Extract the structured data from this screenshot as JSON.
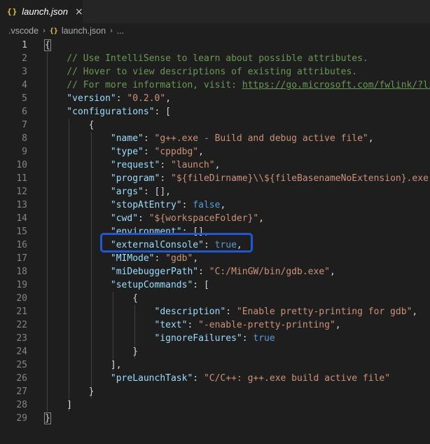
{
  "tab": {
    "icon": "{}",
    "title": "launch.json",
    "close_icon": "×"
  },
  "breadcrumb": {
    "items": [
      ".vscode",
      "launch.json",
      "..."
    ],
    "separator": "›",
    "file_icon": "{}"
  },
  "lines": [
    {
      "n": "1",
      "indent": 0,
      "tokens": [
        {
          "t": "{",
          "c": "p"
        }
      ]
    },
    {
      "n": "2",
      "indent": 1,
      "tokens": [
        {
          "t": "// Use IntelliSense to learn about possible attributes.",
          "c": "c"
        }
      ]
    },
    {
      "n": "3",
      "indent": 1,
      "tokens": [
        {
          "t": "// Hover to view descriptions of existing attributes.",
          "c": "c"
        }
      ]
    },
    {
      "n": "4",
      "indent": 1,
      "tokens": [
        {
          "t": "// For more information, visit: ",
          "c": "c"
        },
        {
          "t": "https://go.microsoft.com/fwlink/?lin",
          "c": "c u"
        }
      ]
    },
    {
      "n": "5",
      "indent": 1,
      "tokens": [
        {
          "t": "\"version\"",
          "c": "k"
        },
        {
          "t": ": ",
          "c": "p"
        },
        {
          "t": "\"0.2.0\"",
          "c": "s"
        },
        {
          "t": ",",
          "c": "p"
        }
      ]
    },
    {
      "n": "6",
      "indent": 1,
      "tokens": [
        {
          "t": "\"configurations\"",
          "c": "k"
        },
        {
          "t": ": [",
          "c": "p"
        }
      ]
    },
    {
      "n": "7",
      "indent": 2,
      "tokens": [
        {
          "t": "{",
          "c": "p"
        }
      ]
    },
    {
      "n": "8",
      "indent": 3,
      "tokens": [
        {
          "t": "\"name\"",
          "c": "k"
        },
        {
          "t": ": ",
          "c": "p"
        },
        {
          "t": "\"g++.exe - Build and debug active file\"",
          "c": "s"
        },
        {
          "t": ",",
          "c": "p"
        }
      ]
    },
    {
      "n": "9",
      "indent": 3,
      "tokens": [
        {
          "t": "\"type\"",
          "c": "k"
        },
        {
          "t": ": ",
          "c": "p"
        },
        {
          "t": "\"cppdbg\"",
          "c": "s"
        },
        {
          "t": ",",
          "c": "p"
        }
      ]
    },
    {
      "n": "10",
      "indent": 3,
      "tokens": [
        {
          "t": "\"request\"",
          "c": "k"
        },
        {
          "t": ": ",
          "c": "p"
        },
        {
          "t": "\"launch\"",
          "c": "s"
        },
        {
          "t": ",",
          "c": "p"
        }
      ]
    },
    {
      "n": "11",
      "indent": 3,
      "tokens": [
        {
          "t": "\"program\"",
          "c": "k"
        },
        {
          "t": ": ",
          "c": "p"
        },
        {
          "t": "\"${fileDirname}\\\\${fileBasenameNoExtension}.exe\"",
          "c": "s"
        },
        {
          "t": ",",
          "c": "p"
        }
      ]
    },
    {
      "n": "12",
      "indent": 3,
      "tokens": [
        {
          "t": "\"args\"",
          "c": "k"
        },
        {
          "t": ": [],",
          "c": "p"
        }
      ]
    },
    {
      "n": "13",
      "indent": 3,
      "tokens": [
        {
          "t": "\"stopAtEntry\"",
          "c": "k"
        },
        {
          "t": ": ",
          "c": "p"
        },
        {
          "t": "false",
          "c": "b"
        },
        {
          "t": ",",
          "c": "p"
        }
      ]
    },
    {
      "n": "14",
      "indent": 3,
      "tokens": [
        {
          "t": "\"cwd\"",
          "c": "k"
        },
        {
          "t": ": ",
          "c": "p"
        },
        {
          "t": "\"${workspaceFolder}\"",
          "c": "s"
        },
        {
          "t": ",",
          "c": "p"
        }
      ]
    },
    {
      "n": "15",
      "indent": 3,
      "tokens": [
        {
          "t": "\"environment\"",
          "c": "k"
        },
        {
          "t": ": [],",
          "c": "p"
        }
      ]
    },
    {
      "n": "16",
      "indent": 3,
      "tokens": [
        {
          "t": "\"externalConsole\"",
          "c": "k"
        },
        {
          "t": ": ",
          "c": "p"
        },
        {
          "t": "true",
          "c": "b"
        },
        {
          "t": ",",
          "c": "p"
        }
      ]
    },
    {
      "n": "17",
      "indent": 3,
      "tokens": [
        {
          "t": "\"MIMode\"",
          "c": "k"
        },
        {
          "t": ": ",
          "c": "p"
        },
        {
          "t": "\"gdb\"",
          "c": "s"
        },
        {
          "t": ",",
          "c": "p"
        }
      ]
    },
    {
      "n": "18",
      "indent": 3,
      "tokens": [
        {
          "t": "\"miDebuggerPath\"",
          "c": "k"
        },
        {
          "t": ": ",
          "c": "p"
        },
        {
          "t": "\"C:/MinGW/bin/gdb.exe\"",
          "c": "s"
        },
        {
          "t": ",",
          "c": "p"
        }
      ]
    },
    {
      "n": "19",
      "indent": 3,
      "tokens": [
        {
          "t": "\"setupCommands\"",
          "c": "k"
        },
        {
          "t": ": [",
          "c": "p"
        }
      ]
    },
    {
      "n": "20",
      "indent": 4,
      "tokens": [
        {
          "t": "{",
          "c": "p"
        }
      ]
    },
    {
      "n": "21",
      "indent": 5,
      "tokens": [
        {
          "t": "\"description\"",
          "c": "k"
        },
        {
          "t": ": ",
          "c": "p"
        },
        {
          "t": "\"Enable pretty-printing for gdb\"",
          "c": "s"
        },
        {
          "t": ",",
          "c": "p"
        }
      ]
    },
    {
      "n": "22",
      "indent": 5,
      "tokens": [
        {
          "t": "\"text\"",
          "c": "k"
        },
        {
          "t": ": ",
          "c": "p"
        },
        {
          "t": "\"-enable-pretty-printing\"",
          "c": "s"
        },
        {
          "t": ",",
          "c": "p"
        }
      ]
    },
    {
      "n": "23",
      "indent": 5,
      "tokens": [
        {
          "t": "\"ignoreFailures\"",
          "c": "k"
        },
        {
          "t": ": ",
          "c": "p"
        },
        {
          "t": "true",
          "c": "b"
        }
      ]
    },
    {
      "n": "24",
      "indent": 4,
      "tokens": [
        {
          "t": "}",
          "c": "p"
        }
      ]
    },
    {
      "n": "25",
      "indent": 3,
      "tokens": [
        {
          "t": "],",
          "c": "p"
        }
      ]
    },
    {
      "n": "26",
      "indent": 3,
      "tokens": [
        {
          "t": "\"preLaunchTask\"",
          "c": "k"
        },
        {
          "t": ": ",
          "c": "p"
        },
        {
          "t": "\"C/C++: g++.exe build active file\"",
          "c": "s"
        }
      ]
    },
    {
      "n": "27",
      "indent": 2,
      "tokens": [
        {
          "t": "}",
          "c": "p"
        }
      ]
    },
    {
      "n": "28",
      "indent": 1,
      "tokens": [
        {
          "t": "]",
          "c": "p"
        }
      ]
    },
    {
      "n": "29",
      "indent": 0,
      "tokens": [
        {
          "t": "}",
          "c": "p"
        }
      ]
    }
  ],
  "active_line": "1",
  "highlighted_line": "16",
  "colors": {
    "background": "#1e1e1e",
    "key": "#9cdcfe",
    "string": "#ce9178",
    "comment": "#6a9955",
    "boolean": "#569cd6",
    "highlight_box": "#1f57d6"
  }
}
